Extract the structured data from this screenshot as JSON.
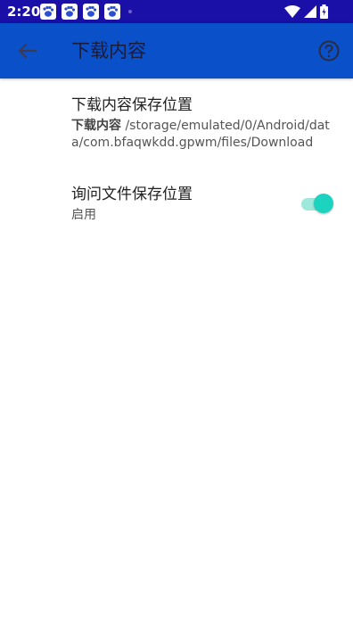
{
  "status_bar": {
    "time": "2:20",
    "notification_icons": [
      "baidu-icon",
      "baidu-icon",
      "baidu-icon",
      "baidu-icon"
    ],
    "icons": [
      "wifi-icon",
      "signal-icon",
      "battery-icon"
    ],
    "background": "#1a0fa6"
  },
  "app_bar": {
    "title": "下载内容",
    "back_icon": "arrow-back-icon",
    "help_icon": "help-circle-icon",
    "background": "#0a50c8"
  },
  "preferences": [
    {
      "title": "下载内容保存位置",
      "summary_bold": "下载内容",
      "summary_path": " /storage/emulated/0/Android/data/com.bfaqwkdd.gpwm/files/Download"
    },
    {
      "title": "询问文件保存位置",
      "summary": "启用",
      "switch_on": true,
      "accent": "#1cd3bf"
    }
  ]
}
